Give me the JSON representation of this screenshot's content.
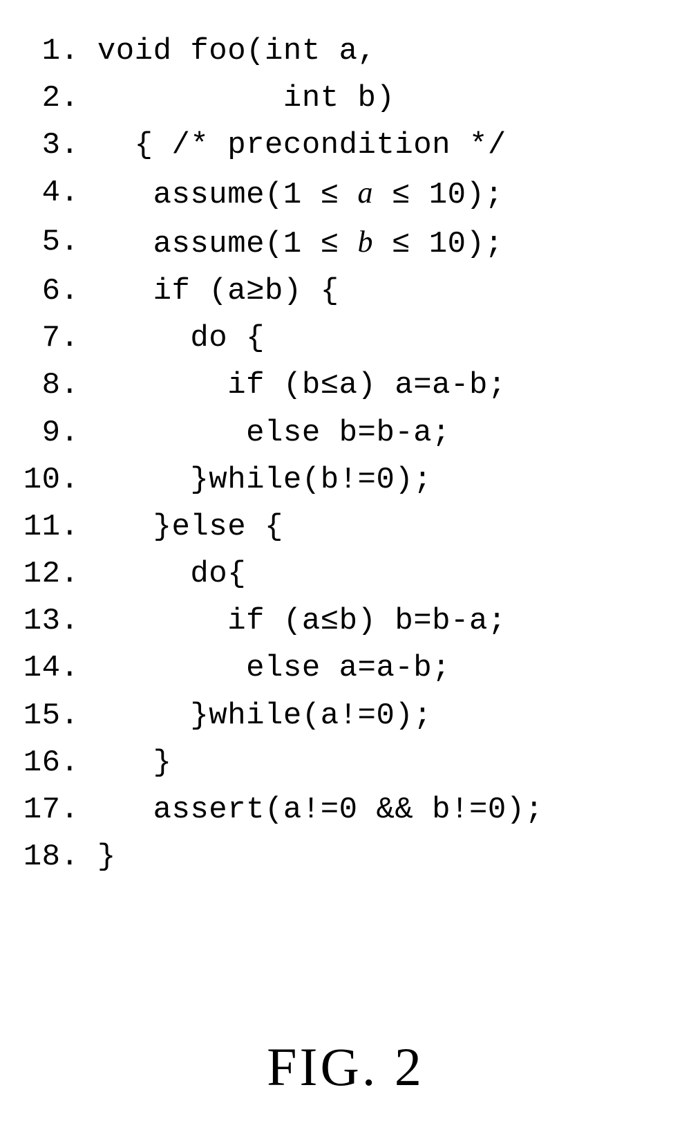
{
  "figure_label": "FIG. 2",
  "code": {
    "lines": [
      {
        "n": "1.",
        "segs": [
          [
            "t",
            "void foo(int a,"
          ]
        ]
      },
      {
        "n": "2.",
        "segs": [
          [
            "t",
            "          int b)"
          ]
        ]
      },
      {
        "n": "3.",
        "segs": [
          [
            "t",
            "  { /* precondition */"
          ]
        ]
      },
      {
        "n": "4.",
        "segs": [
          [
            "t",
            "   assume(1 ≤ "
          ],
          [
            "i",
            "a"
          ],
          [
            "t",
            " ≤ 10);"
          ]
        ]
      },
      {
        "n": "5.",
        "segs": [
          [
            "t",
            "   assume(1 ≤ "
          ],
          [
            "i",
            "b"
          ],
          [
            "t",
            " ≤ 10);"
          ]
        ]
      },
      {
        "n": "6.",
        "segs": [
          [
            "t",
            "   if (a≥b) {"
          ]
        ]
      },
      {
        "n": "7.",
        "segs": [
          [
            "t",
            "     do {"
          ]
        ]
      },
      {
        "n": "8.",
        "segs": [
          [
            "t",
            "       if (b≤a) a=a-b;"
          ]
        ]
      },
      {
        "n": "9.",
        "segs": [
          [
            "t",
            "        else b=b-a;"
          ]
        ]
      },
      {
        "n": "10.",
        "segs": [
          [
            "t",
            "     }while(b!=0);"
          ]
        ]
      },
      {
        "n": "11.",
        "segs": [
          [
            "t",
            "   }else {"
          ]
        ]
      },
      {
        "n": "12.",
        "segs": [
          [
            "t",
            "     do{"
          ]
        ]
      },
      {
        "n": "13.",
        "segs": [
          [
            "t",
            "       if (a≤b) b=b-a;"
          ]
        ]
      },
      {
        "n": "14.",
        "segs": [
          [
            "t",
            "        else a=a-b;"
          ]
        ]
      },
      {
        "n": "15.",
        "segs": [
          [
            "t",
            "     }while(a!=0);"
          ]
        ]
      },
      {
        "n": "16.",
        "segs": [
          [
            "t",
            "   }"
          ]
        ]
      },
      {
        "n": "17.",
        "segs": [
          [
            "t",
            "   assert(a!=0 && b!=0);"
          ]
        ]
      },
      {
        "n": "18.",
        "segs": [
          [
            "t",
            "}"
          ]
        ]
      }
    ]
  }
}
